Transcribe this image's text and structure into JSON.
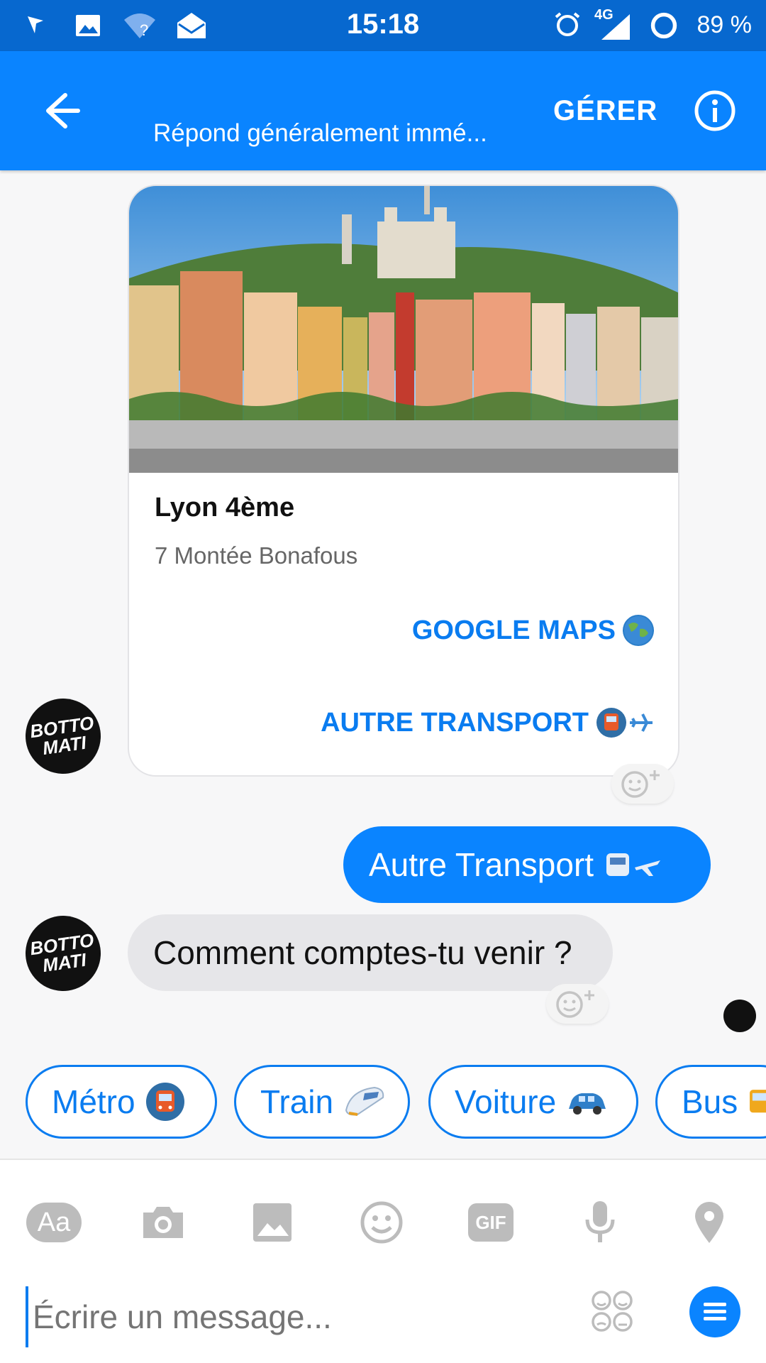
{
  "status_bar": {
    "time": "15:18",
    "network": "4G",
    "battery": "89 %",
    "icons": [
      "flag-icon",
      "image-icon",
      "wifi-question-icon",
      "mail-icon",
      "alarm-icon",
      "signal-icon",
      "battery-ring-icon"
    ]
  },
  "header": {
    "subtitle": "Répond généralement immé...",
    "manage_label": "GÉRER",
    "icons": [
      "back-arrow-icon",
      "info-icon"
    ]
  },
  "card": {
    "title": "Lyon 4ème",
    "address": "7 Montée Bonafous",
    "buttons": [
      {
        "label": "GOOGLE MAPS",
        "icon": "globe-emoji-icon"
      },
      {
        "label": "AUTRE TRANSPORT",
        "icon": "metro-plane-emoji-icon"
      }
    ]
  },
  "avatar_text": "BOTTO\nMATI",
  "messages": [
    {
      "from": "user",
      "text": "Autre Transport"
    },
    {
      "from": "bot",
      "text": "Comment comptes-tu venir ?"
    }
  ],
  "quick_replies": [
    {
      "label": "Métro",
      "icon": "metro-emoji-icon"
    },
    {
      "label": "Train",
      "icon": "train-emoji-icon"
    },
    {
      "label": "Voiture",
      "icon": "car-emoji-icon"
    },
    {
      "label": "Bus",
      "icon": "bus-emoji-icon"
    }
  ],
  "composer": {
    "tools": [
      "text-format-icon",
      "camera-icon",
      "gallery-icon",
      "emoji-icon",
      "gif-icon",
      "microphone-icon",
      "location-icon"
    ],
    "aa_label": "Aa",
    "gif_label": "GIF",
    "placeholder": "Écrire un message..."
  },
  "colors": {
    "status_bar": "#0768cf",
    "header": "#0a84ff",
    "accent": "#0a7cf0",
    "incoming_bubble": "#e6e6e9"
  }
}
